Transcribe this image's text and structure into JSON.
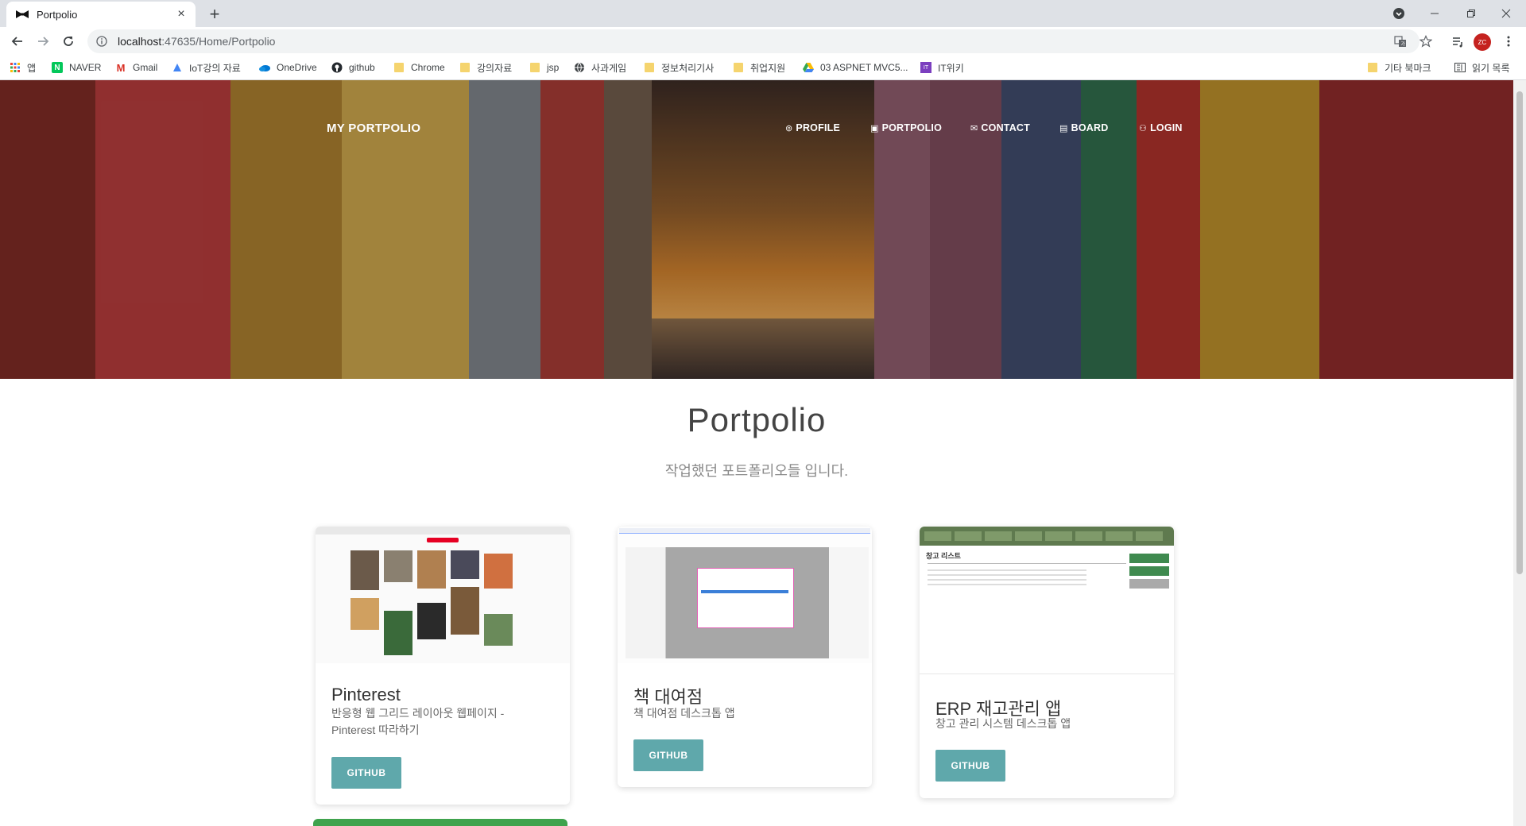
{
  "browser": {
    "tab_title": "Portpolio",
    "url_host": "localhost",
    "url_rest": ":47635/Home/Portpolio",
    "bookmarks": [
      {
        "label": "앱",
        "icon": "apps-grid-icon"
      },
      {
        "label": "NAVER",
        "icon": "naver-icon"
      },
      {
        "label": "Gmail",
        "icon": "gmail-icon"
      },
      {
        "label": "IoT강의 자료",
        "icon": "drive-icon"
      },
      {
        "label": "OneDrive",
        "icon": "onedrive-icon"
      },
      {
        "label": "github",
        "icon": "github-icon"
      },
      {
        "label": "Chrome",
        "icon": "folder-icon"
      },
      {
        "label": "강의자료",
        "icon": "folder-icon"
      },
      {
        "label": "jsp",
        "icon": "folder-icon"
      },
      {
        "label": "사과게임",
        "icon": "globe-icon"
      },
      {
        "label": "정보처리기사",
        "icon": "folder-icon"
      },
      {
        "label": "취업지원",
        "icon": "folder-icon"
      },
      {
        "label": "03 ASPNET MVC5...",
        "icon": "drive-icon"
      },
      {
        "label": "IT위키",
        "icon": "itwiki-icon"
      },
      {
        "label": "기타 북마크",
        "icon": "folder-icon"
      },
      {
        "label": "읽기 목록",
        "icon": "reading-list-icon"
      }
    ],
    "avatar_text": "ZC"
  },
  "site": {
    "brand": "MY PORTPOLIO",
    "nav": [
      {
        "label": "PROFILE",
        "icon": "⊚"
      },
      {
        "label": "PORTPOLIO",
        "icon": "▣"
      },
      {
        "label": "CONTACT",
        "icon": "✉"
      },
      {
        "label": "BOARD",
        "icon": "▤"
      },
      {
        "label": "LOGIN",
        "icon": "⚇"
      }
    ]
  },
  "section": {
    "title": "Portpolio",
    "subtitle": "작업했던 포트폴리오들 입니다."
  },
  "cards": [
    {
      "title": "Pinterest",
      "desc_line1": "반응형 웹 그리드 레이아웃 웹페이지 -",
      "desc_line2": "Pinterest 따라하기",
      "button": "GITHUB"
    },
    {
      "title": "책 대여점",
      "desc_line1": "책 대여점 데스크톱 앱",
      "button": "GITHUB"
    },
    {
      "title": "ERP 재고관리 앱",
      "desc_line1": "창고 관리 시스템 데스크톱 앱",
      "button": "GITHUB"
    }
  ],
  "thumbs": {
    "erp_heading": "창고 리스트"
  },
  "colors": {
    "button": "#5fa8ab",
    "tabstrip": "#dee1e6"
  }
}
